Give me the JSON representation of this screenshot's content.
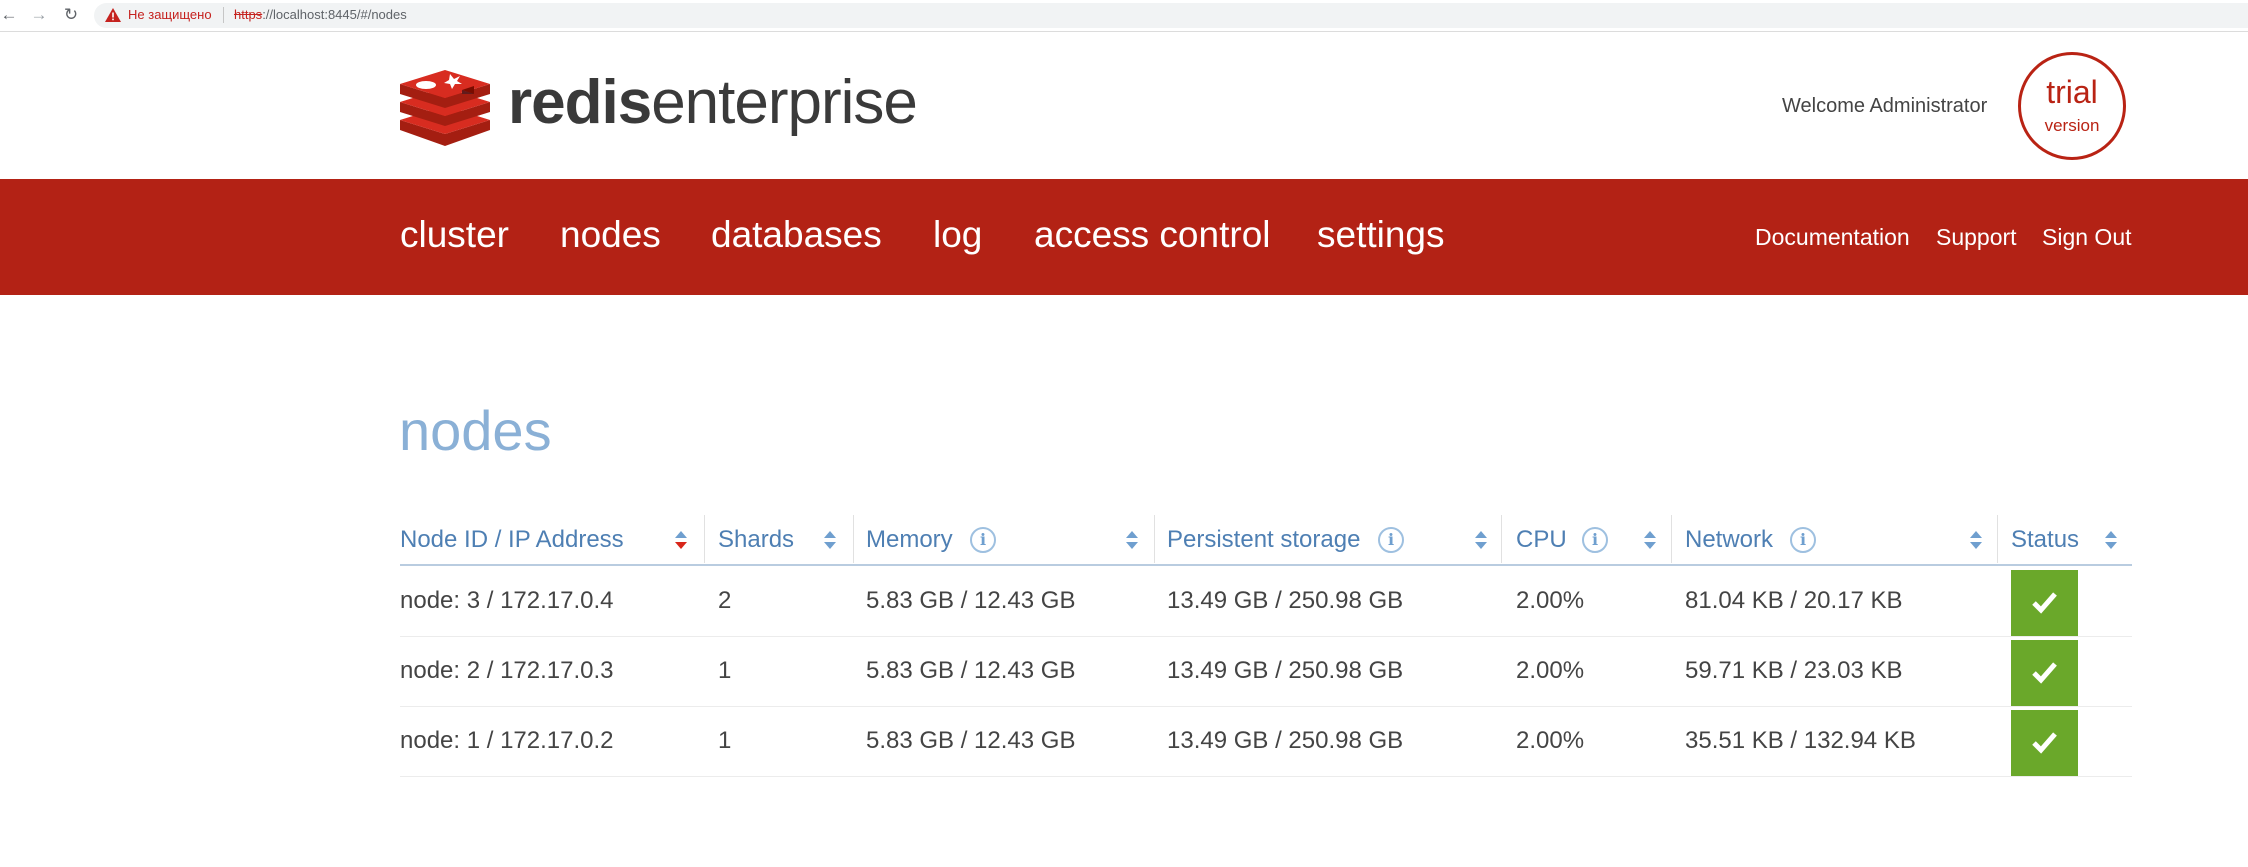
{
  "browser": {
    "security_label": "Не защищено",
    "url_scheme": "https",
    "url_rest": "://localhost:8445/#/nodes"
  },
  "header": {
    "logo_bold": "redis",
    "logo_light": "enterprise",
    "welcome": "Welcome Administrator",
    "trial_line1": "trial",
    "trial_line2": "version"
  },
  "nav": {
    "items": [
      {
        "label": "cluster"
      },
      {
        "label": "nodes"
      },
      {
        "label": "databases"
      },
      {
        "label": "log"
      },
      {
        "label": "access control"
      },
      {
        "label": "settings"
      }
    ],
    "right_links": [
      {
        "label": "Documentation"
      },
      {
        "label": "Support"
      },
      {
        "label": "Sign Out"
      }
    ]
  },
  "page": {
    "title": "nodes"
  },
  "table": {
    "columns": [
      {
        "label": "Node ID / IP Address"
      },
      {
        "label": "Shards"
      },
      {
        "label": "Memory"
      },
      {
        "label": "Persistent storage"
      },
      {
        "label": "CPU"
      },
      {
        "label": "Network"
      },
      {
        "label": "Status"
      }
    ],
    "rows": [
      {
        "node": "node: 3 / 172.17.0.4",
        "shards": "2",
        "memory": "5.83 GB / 12.43 GB",
        "storage": "13.49 GB / 250.98 GB",
        "cpu": "2.00%",
        "network": "81.04 KB / 20.17 KB",
        "status": "ok"
      },
      {
        "node": "node: 2 / 172.17.0.3",
        "shards": "1",
        "memory": "5.83 GB / 12.43 GB",
        "storage": "13.49 GB / 250.98 GB",
        "cpu": "2.00%",
        "network": "59.71 KB / 23.03 KB",
        "status": "ok"
      },
      {
        "node": "node: 1 / 172.17.0.2",
        "shards": "1",
        "memory": "5.83 GB / 12.43 GB",
        "storage": "13.49 GB / 250.98 GB",
        "cpu": "2.00%",
        "network": "35.51 KB / 132.94 KB",
        "status": "ok"
      }
    ],
    "sort": {
      "column": "Node ID / IP Address",
      "direction": "descending"
    }
  },
  "colors": {
    "brand_red": "#b32215",
    "title_blue": "#8ab0d6",
    "header_blue": "#4e7fb3",
    "status_green": "#6aa82a"
  }
}
